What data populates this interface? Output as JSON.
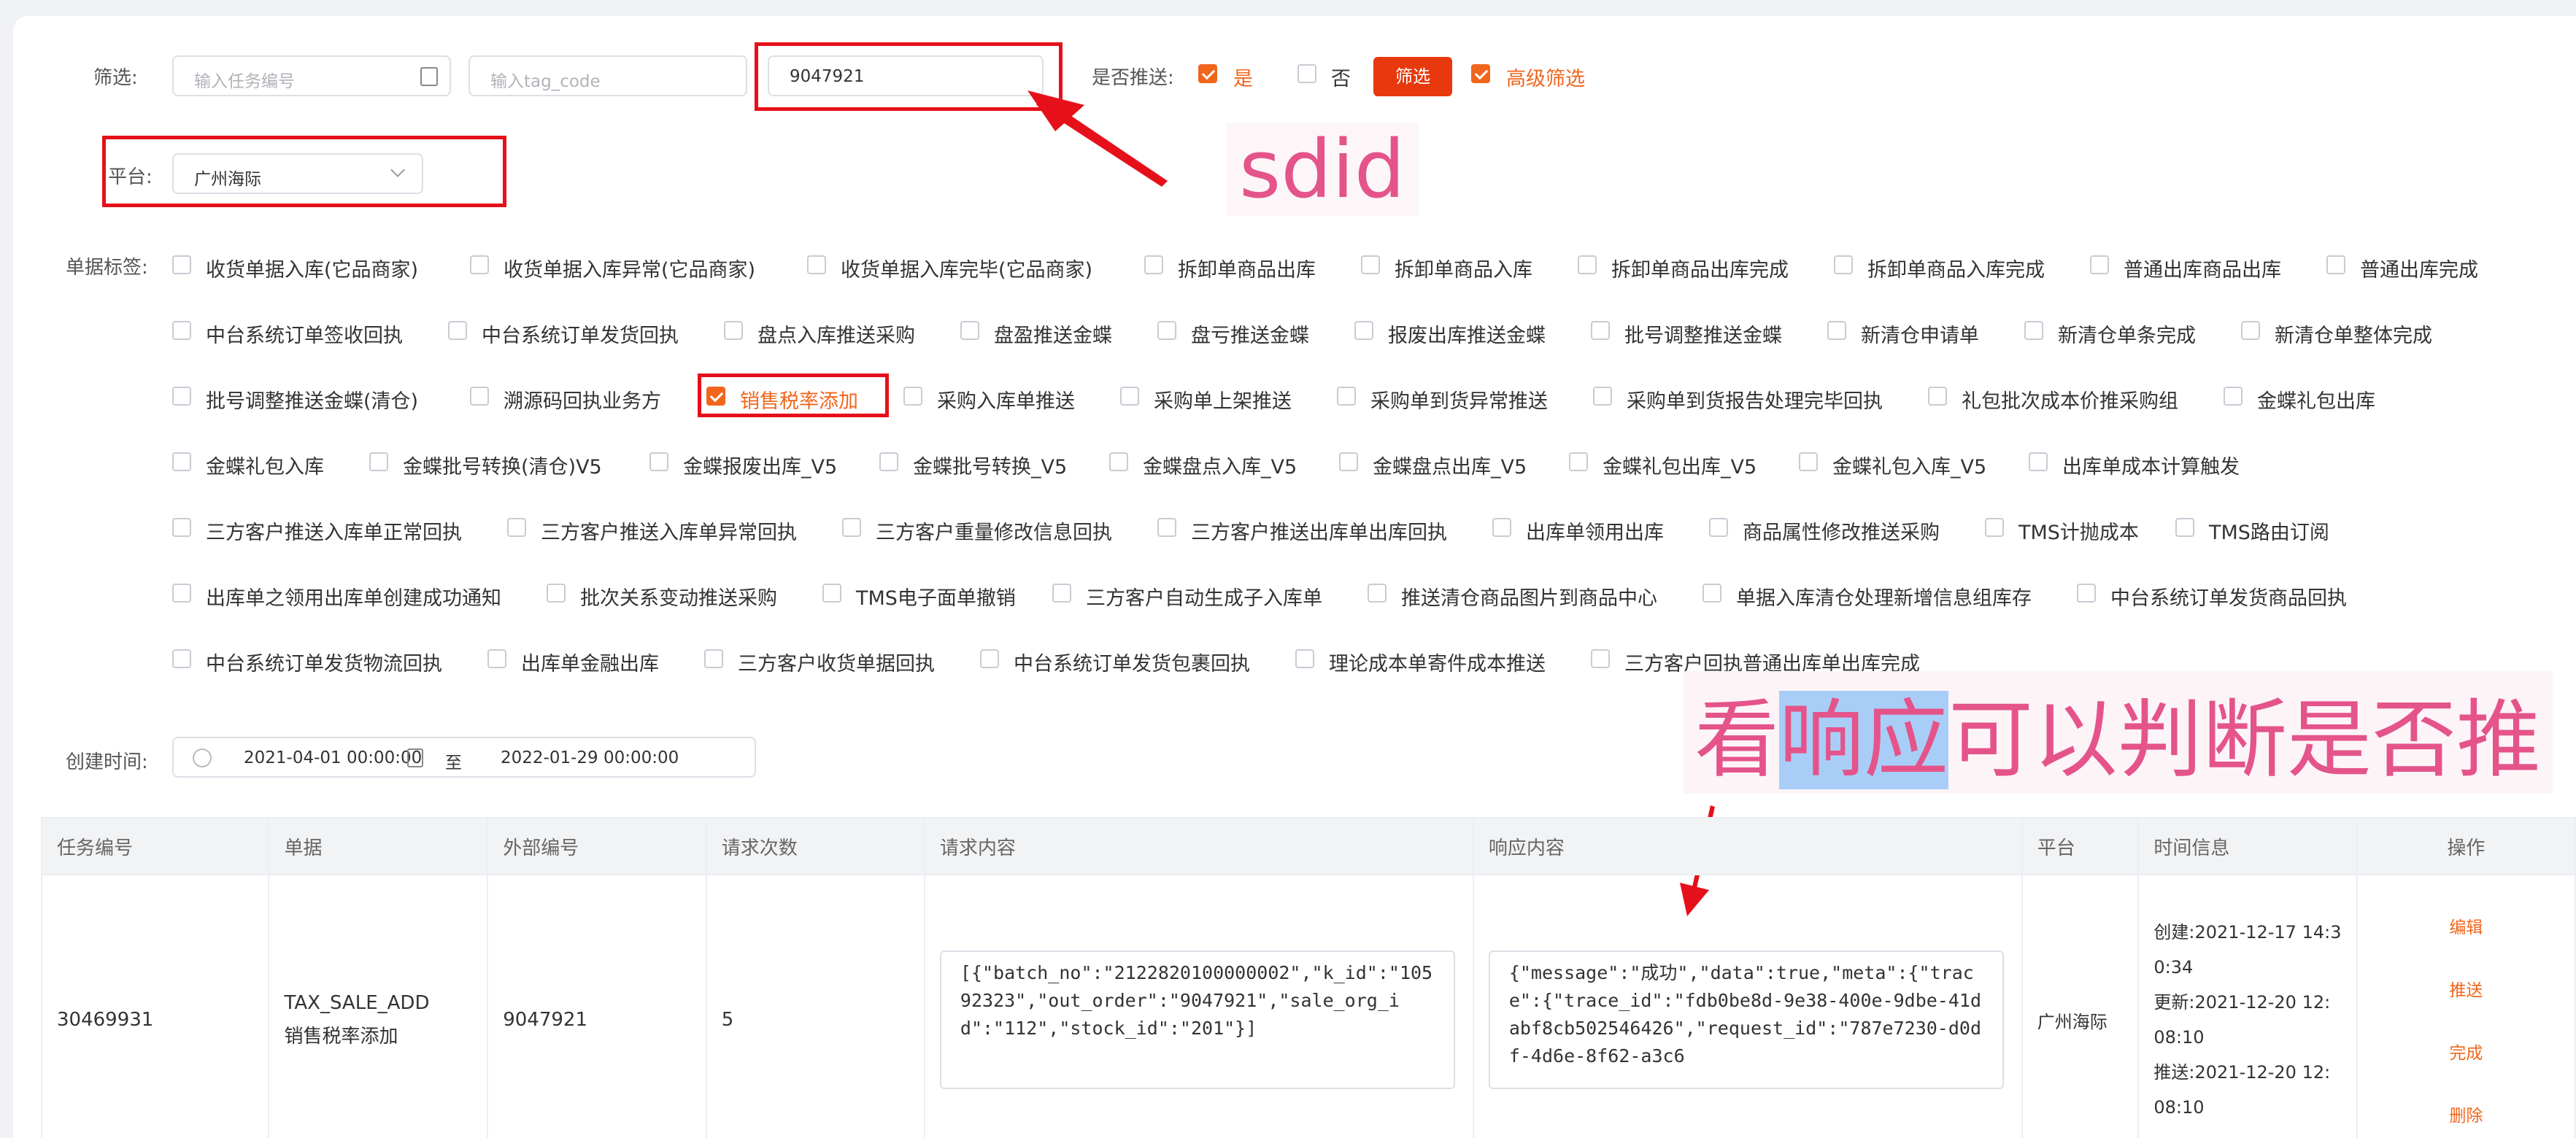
{
  "filter": {
    "label": "筛选:",
    "task_placeholder": "输入任务编号",
    "tag_placeholder": "输入tag_code",
    "sdid_value": "9047921",
    "push_label": "是否推送:",
    "push_yes": "是",
    "push_no": "否",
    "filter_button": "筛选",
    "advanced_label": "高级筛选"
  },
  "platform": {
    "label": "平台:",
    "value": "广州海际"
  },
  "annotations": {
    "sdid": "sdid",
    "response_note": "看响应可以判断是否推",
    "response_note_highlight": "响应"
  },
  "tags": {
    "label": "单据标签:",
    "rows": [
      [
        "收货单据入库(它品商家)",
        "收货单据入库异常(它品商家)",
        "收货单据入库完毕(它品商家)",
        "拆卸单商品出库",
        "拆卸单商品入库",
        "拆卸单商品出库完成",
        "拆卸单商品入库完成",
        "普通出库商品出库",
        "普通出库完成"
      ],
      [
        "中台系统订单签收回执",
        "中台系统订单发货回执",
        "盘点入库推送采购",
        "盘盈推送金蝶",
        "盘亏推送金蝶",
        "报废出库推送金蝶",
        "批号调整推送金蝶",
        "新清仓申请单",
        "新清仓单条完成",
        "新清仓单整体完成"
      ],
      [
        "批号调整推送金蝶(清仓)",
        "溯源码回执业务方",
        "销售税率添加",
        "采购入库单推送",
        "采购单上架推送",
        "采购单到货异常推送",
        "采购单到货报告处理完毕回执",
        "礼包批次成本价推采购组",
        "金蝶礼包出库"
      ],
      [
        "金蝶礼包入库",
        "金蝶批号转换(清仓)V5",
        "金蝶报废出库_V5",
        "金蝶批号转换_V5",
        "金蝶盘点入库_V5",
        "金蝶盘点出库_V5",
        "金蝶礼包出库_V5",
        "金蝶礼包入库_V5",
        "出库单成本计算触发"
      ],
      [
        "三方客户推送入库单正常回执",
        "三方客户推送入库单异常回执",
        "三方客户重量修改信息回执",
        "三方客户推送出库单出库回执",
        "出库单领用出库",
        "商品属性修改推送采购",
        "TMS计抛成本",
        "TMS路由订阅"
      ],
      [
        "出库单之领用出库单创建成功通知",
        "批次关系变动推送采购",
        "TMS电子面单撤销",
        "三方客户自动生成子入库单",
        "推送清仓商品图片到商品中心",
        "单据入库清仓处理新增信息组库存",
        "中台系统订单发货商品回执"
      ],
      [
        "中台系统订单发货物流回执",
        "出库单金融出库",
        "三方客户收货单据回执",
        "中台系统订单发货包裹回执",
        "理论成本单寄件成本推送",
        "三方客户回执普通出库单出库完成"
      ]
    ]
  },
  "created_time": {
    "label": "创建时间:",
    "start": "2021-04-01 00:00:00",
    "separator": "至",
    "end": "2022-01-29 00:00:00"
  },
  "table": {
    "headers": [
      "任务编号",
      "单据",
      "外部编号",
      "请求次数",
      "请求内容",
      "响应内容",
      "平台",
      "时间信息",
      "操作"
    ],
    "row": {
      "task_id": "30469931",
      "doc_code": "TAX_SALE_ADD",
      "doc_name": "销售税率添加",
      "external_id": "9047921",
      "request_count": "5",
      "request": "[{\"batch_no\":\"2122820100000002\",\"k_id\":\"10592323\",\"out_order\":\"9047921\",\"sale_org_id\":\"112\",\"stock_id\":\"201\"}]",
      "response": "{\"message\":\"成功\",\"data\":true,\"meta\":{\"trace\":{\"trace_id\":\"fdb0be8d-9e38-400e-9dbe-41dabf8cb502546426\",\"request_id\":\"787e7230-d0df-4d6e-8f62-a3c6",
      "platform": "广州海际",
      "time_created": "创建:2021-12-17 14:3",
      "time_created_2": "0:34",
      "time_updated": "更新:2021-12-20 12:",
      "time_updated_2": "08:10",
      "time_pushed": "推送:2021-12-20 12:",
      "time_pushed_2": "08:10",
      "ops": [
        "编辑",
        "推送",
        "完成",
        "删除"
      ]
    }
  },
  "colors": {
    "accent": "#f0661d",
    "red_box": "#e6101a",
    "annotation": "#e4548a"
  }
}
